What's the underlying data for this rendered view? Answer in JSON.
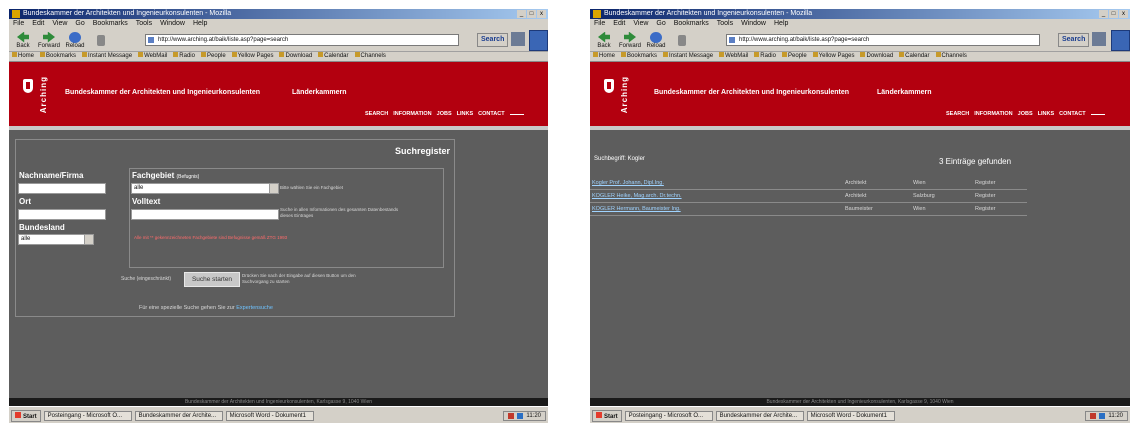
{
  "browser": {
    "title": "Bundeskammer der Architekten und Ingenieurkonsulenten - Mozilla",
    "menu": [
      "File",
      "Edit",
      "View",
      "Go",
      "Bookmarks",
      "Tools",
      "Window",
      "Help"
    ],
    "toolbar": {
      "back": "Back",
      "forward": "Forward",
      "reload": "Reload",
      "search": "Search",
      "print": "Print"
    },
    "url": "http://www.arching.at/baik/liste.asp?page=search",
    "bookmarks": [
      "Home",
      "Bookmarks",
      "Instant Message",
      "WebMail",
      "Radio",
      "People",
      "Yellow Pages",
      "Download",
      "Calendar",
      "Channels"
    ],
    "window_controls": [
      "_",
      "□",
      "x"
    ]
  },
  "site": {
    "logo_text": "Arching",
    "chamber_name": "Bundeskammer der Architekten und Ingenieurkonsulenten",
    "chambers_link": "Länderkammern",
    "nav": [
      "SEARCH",
      "INFORMATION",
      "JOBS",
      "LINKS",
      "CONTACT"
    ],
    "footer": "Bundeskammer der Architekten und Ingenieurkonsulenten, Karlsgasse 9, 1040 Wien"
  },
  "search_form": {
    "title": "Suchregister",
    "name_label": "Nachname/Firma",
    "name_value": "",
    "city_label": "Ort",
    "city_value": "",
    "state_label": "Bundesland",
    "state_value": "alle",
    "field_label": "Fachgebiet",
    "field_label_small": "(Befugnis)",
    "field_value": "alle",
    "field_hint": "Bitte wählen Sie ein Fachgebiet",
    "fulltext_label": "Volltext",
    "fulltext_value": "",
    "fulltext_hint": "Suche in allen Informationen des gesamten Datenbestands dieses Eintrages",
    "remark": "Alle mit ** gekennzeichneten Fachgebiete sind Befugnisse gemäß ZTG 1993",
    "search_prefix": "Suche (eingeschränkt)",
    "search_button": "Suche starten",
    "search_hint": "Drücken Sie nach der Eingabe auf diesen Button um den Suchvorgang zu starten",
    "expert_text": "Für eine spezielle Suche gehen Sie zur",
    "expert_link": "Expertensuche"
  },
  "results": {
    "search_term": "Suchbegriff: Kogler",
    "count_text": "3 Einträge gefunden",
    "rows": [
      {
        "name": "Kogler Prof. Johann, Dipl.Ing.",
        "role": "Architekt",
        "city": "Wien",
        "register": "Register"
      },
      {
        "name": "KOGLER Heike, Mag.arch. Dr.techn.",
        "role": "Architekt",
        "city": "Salzburg",
        "register": "Register"
      },
      {
        "name": "KOGLER Hermann, Baumeister Ing.",
        "role": "Baumeister",
        "city": "Wien",
        "register": "Register"
      }
    ]
  },
  "taskbar": {
    "start": "Start",
    "tasks": [
      "Posteingang - Microsoft O...",
      "Bundeskammer der Archite...",
      "Microsoft Word - Dokument1"
    ],
    "clock": "11:20"
  },
  "colors": {
    "banner": "#b3000f",
    "content": "#5d5d5d",
    "link": "#9fd3ff"
  }
}
